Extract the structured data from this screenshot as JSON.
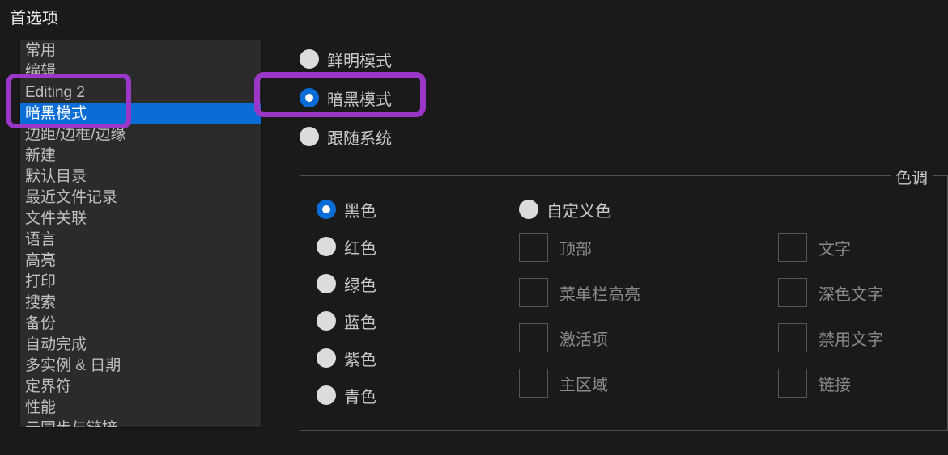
{
  "header": {
    "title": "首选项"
  },
  "sidebar": {
    "selected_index": 3,
    "items": [
      "常用",
      "编辑",
      "Editing 2",
      "暗黑模式",
      "边距/边框/边缘",
      "新建",
      "默认目录",
      "最近文件记录",
      "文件关联",
      "语言",
      "高亮",
      "打印",
      "搜索",
      "备份",
      "自动完成",
      "多实例 & 日期",
      "定界符",
      "性能",
      "云同步与链接"
    ]
  },
  "mode_radios": {
    "selected_index": 1,
    "options": [
      "鲜明模式",
      "暗黑模式",
      "跟随系统"
    ]
  },
  "tint": {
    "legend": "色调",
    "color_selected_index": 0,
    "colors": [
      "黑色",
      "红色",
      "绿色",
      "蓝色",
      "紫色",
      "青色"
    ],
    "custom_label": "自定义色",
    "swatches_a": [
      "顶部",
      "菜单栏高亮",
      "激活项",
      "主区域"
    ],
    "swatches_b": [
      "文字",
      "深色文字",
      "禁用文字",
      "链接"
    ]
  }
}
